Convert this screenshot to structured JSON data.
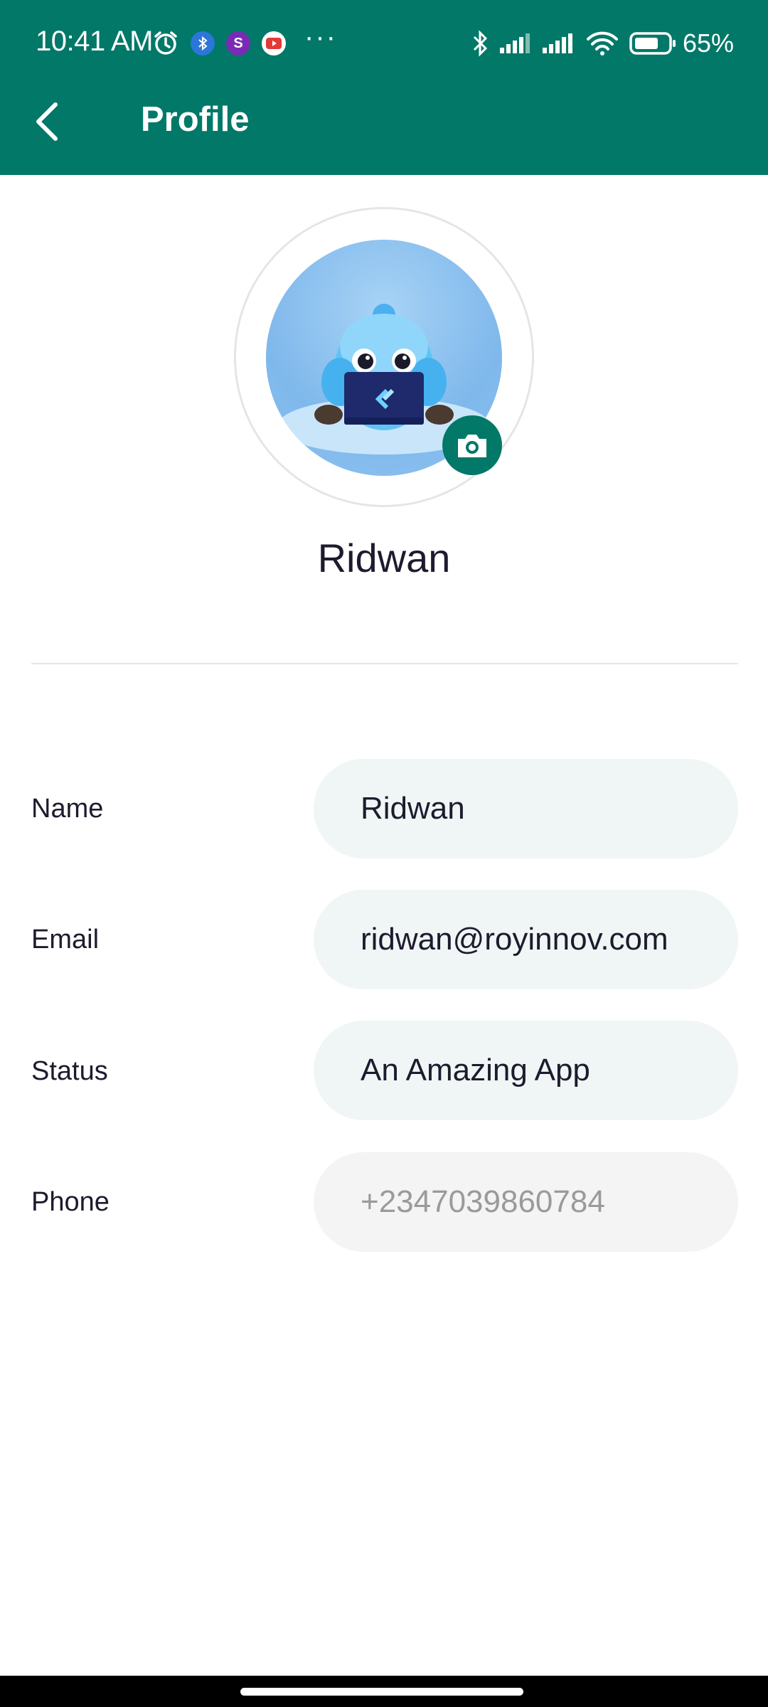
{
  "status_bar": {
    "time": "10:41 AM",
    "more": "···",
    "battery_percent": "65%",
    "icons": [
      "alarm-icon",
      "bluetooth-notification-icon",
      "s-app-icon",
      "youtube-icon",
      "bluetooth-icon",
      "signal-icon",
      "signal-icon",
      "wifi-icon",
      "battery-icon"
    ]
  },
  "appbar": {
    "title": "Profile",
    "back_icon": "chevron-left-icon",
    "color": "#027868"
  },
  "profile": {
    "display_name": "Ridwan",
    "camera_icon": "camera-icon"
  },
  "fields": [
    {
      "label": "Name",
      "value": "Ridwan",
      "editable": true
    },
    {
      "label": "Email",
      "value": "ridwan@royinnov.com",
      "editable": true
    },
    {
      "label": "Status",
      "value": "An Amazing App",
      "editable": true
    },
    {
      "label": "Phone",
      "value": "+2347039860784",
      "editable": false
    }
  ]
}
